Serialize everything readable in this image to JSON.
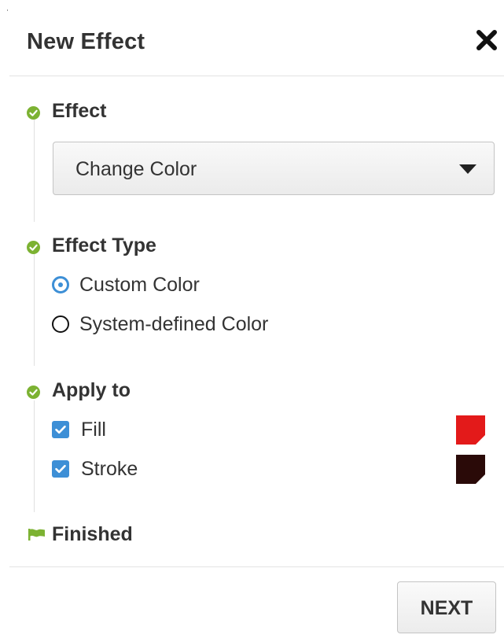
{
  "dialog": {
    "title": "New Effect",
    "close_icon": "close-icon"
  },
  "colors": {
    "accent": "#3d8fd6",
    "step_done": "#7cb232",
    "fill_swatch": "#e31a1a",
    "stroke_swatch": "#2a0a08"
  },
  "steps": {
    "effect": {
      "title": "Effect",
      "icon": "check-circle-icon",
      "select": {
        "value": "Change Color",
        "icon": "caret-down-icon"
      }
    },
    "effect_type": {
      "title": "Effect Type",
      "icon": "check-circle-icon",
      "options": [
        {
          "label": "Custom Color",
          "selected": true
        },
        {
          "label": "System-defined Color",
          "selected": false
        }
      ]
    },
    "apply_to": {
      "title": "Apply to",
      "icon": "check-circle-icon",
      "items": [
        {
          "label": "Fill",
          "checked": true,
          "swatch_color": "#e31a1a"
        },
        {
          "label": "Stroke",
          "checked": true,
          "swatch_color": "#2a0a08"
        }
      ]
    },
    "finished": {
      "title": "Finished",
      "icon": "flag-icon"
    }
  },
  "footer": {
    "next_label": "NEXT"
  }
}
